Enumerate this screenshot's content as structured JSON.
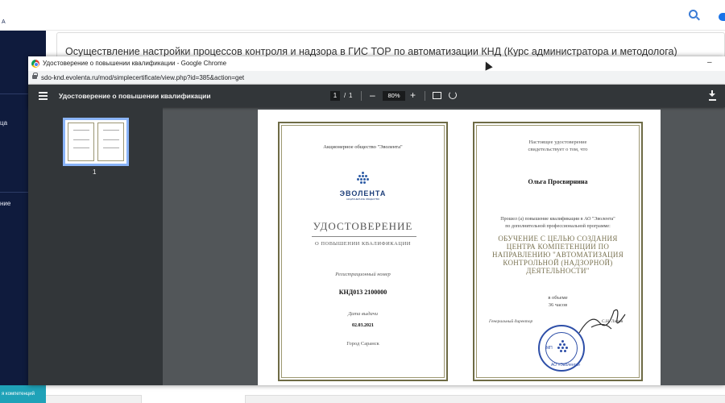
{
  "lms": {
    "logo_text": "А",
    "sidebar_labels": [
      "ца",
      "ние"
    ],
    "sidebar_footer": "я компетенций",
    "course_title": "Осуществление настройки процессов контроля и надзора в ГИС ТОР по автоматизации КНД (Курс администратора и методолога)"
  },
  "browser": {
    "window_title": "Удостоверение о повышении квалификации - Google Chrome",
    "minimize": "–",
    "url": "sdo-knd.evolenta.ru/mod/simplecertificate/view.php?id=385&action=get"
  },
  "pdf_toolbar": {
    "title": "Удостоверение о повышении квалификации",
    "page_current": "1",
    "page_sep": "/",
    "page_total": "1",
    "zoom_out": "–",
    "zoom": "80%",
    "zoom_in": "+"
  },
  "thumbnails": {
    "page_label": "1"
  },
  "certificate": {
    "left": {
      "org": "Акционерное общество \"Эволента\"",
      "logo_text": "ЭВОЛЕНТА",
      "logo_sub": "АКЦИОНЕРНОЕ ОБЩЕСТВО",
      "heading": "УДОСТОВЕРЕНИЕ",
      "subheading": "О ПОВЫШЕНИИ КВАЛИФИКАЦИИ",
      "reg_label": "Регистрационный номер",
      "reg_number": "КНД013 2100000",
      "issue_label": "Дата выдачи",
      "issue_date": "02.03.2021",
      "city": "Город Саранск"
    },
    "right": {
      "intro_1": "Настоящее удостоверение",
      "intro_2": "свидетельствует о том, что",
      "name": "Ольга Просвирнина",
      "text_1": "Прошел (а) повышение квалификации в АО \"Эволента\"",
      "text_2": "по дополнительной профессиональной программе:",
      "program_lines": [
        "ОБУЧЕНИЕ С ЦЕЛЬЮ СОЗДАНИЯ",
        "ЦЕНТРА КОМПЕТЕНЦИИ ПО",
        "НАПРАВЛЕНИЮ \"АВТОМАТИЗАЦИЯ",
        "КОНТРОЛЬНОЙ (НАДЗОРНОЙ)",
        "ДЕЯТЕЛЬНОСТИ\""
      ],
      "volume_1": "в объеме",
      "volume_2": "36 часов",
      "director_label": "Генеральный директор",
      "director_name": "С.Н. Лизин",
      "stamp_mp": "МП",
      "stamp_text": "АО «Эволента»"
    }
  },
  "colors": {
    "frame": "#6e6b45",
    "program_text": "#7a7352",
    "stamp": "#2e4fa8",
    "logo": "#1e3f7a"
  }
}
